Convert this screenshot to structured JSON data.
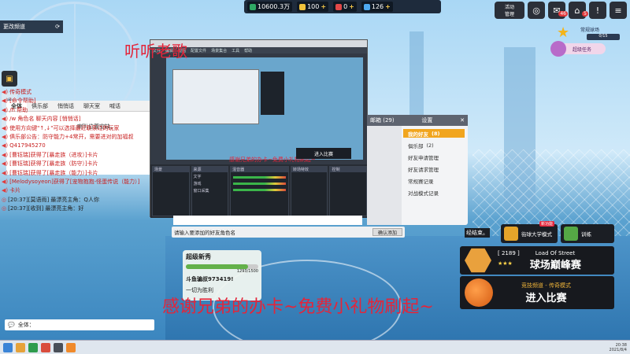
{
  "topbar": {
    "rank_points": "10600.3万",
    "coins": "100",
    "gems": "0",
    "tickets": "126"
  },
  "top_icons": {
    "event_label": "活动",
    "manager_label": "管理",
    "badge_mail": "46",
    "badge_store": "5"
  },
  "left": {
    "channel_button": "更改频道",
    "side_icon_labels": [
      "",
      "",
      ""
    ],
    "chat_tabs": [
      "全体",
      "俱乐部",
      "悄悄话",
      "聊天室",
      "喊话"
    ],
    "notice_text": "喇叭位置空缺。",
    "chat_lines": [
      {
        "cls": "red",
        "text": "传奇模式"
      },
      {
        "cls": "red",
        "text": "[命令帮助]"
      },
      {
        "cls": "red",
        "text": "/h 帮助"
      },
      {
        "cls": "red",
        "text": "/w 角色名 聊天内容 [悄悄话]"
      },
      {
        "cls": "red",
        "text": "使用方向键\"↑,↓\"可以选择最近联系过的玩家"
      },
      {
        "cls": "red",
        "text": "俱乐部公告：防守能力+4常开，需要进对的加福叔"
      },
      {
        "cls": "red",
        "text": "Q417945270"
      },
      {
        "cls": "red",
        "text": "[曹钰瑞]获得了[暴走族（进攻）]卡片"
      },
      {
        "cls": "red",
        "text": "[曹钰瑞]获得了[暴走族（防守）]卡片"
      },
      {
        "cls": "red",
        "text": "[曹钰瑞]获得了[暴走族（能力）]卡片"
      },
      {
        "cls": "red",
        "text": "[Melodysoyeon]获得了[宠物抱抱-怪蛋传说（能力）]"
      },
      {
        "cls": "red",
        "text": "卡片"
      },
      {
        "cls": "dark",
        "text": "[20:37][莫语雨] 最漂亮主角：Q人你"
      },
      {
        "cls": "dark",
        "text": "[20:37][收到] 最漂亮主角：好"
      }
    ],
    "chat_input_label": "全体："
  },
  "overlay": {
    "title": "听听老歌",
    "subtitle": "感谢兄弟的办卡~免费小礼物刷起~"
  },
  "obs": {
    "menu": [
      "文件",
      "编辑",
      "视图",
      "配置文件",
      "场景集合",
      "工具",
      "帮助"
    ],
    "preview_text": "感谢兄弟的办卡~免费小礼物刷起~",
    "preview_btn": "进入比赛",
    "docks": [
      "场景",
      "来源",
      "混音器",
      "转场特效",
      "控制"
    ],
    "sources": [
      "文字",
      "游戏",
      "窗口采集"
    ]
  },
  "settings": {
    "tab_mail": "邮箱",
    "mail_count": "(29)",
    "title": "设置",
    "items": [
      {
        "label": "我的好友",
        "count": "(8)",
        "active": true
      },
      {
        "label": "俱乐部",
        "count": "(2)",
        "active": false
      },
      {
        "label": "好友申请管理",
        "count": "",
        "active": false
      },
      {
        "label": "好友请求管理",
        "count": "",
        "active": false
      },
      {
        "label": "常规赛记录",
        "count": "",
        "active": false
      },
      {
        "label": "对战模式记录",
        "count": "",
        "active": false
      }
    ]
  },
  "middle": {
    "add_placeholder": "请输入要添加的好友角色名",
    "add_button": "确认添加",
    "end_label": "经结束。"
  },
  "season": {
    "title": "超级新秀",
    "progress_text": "1293/1500",
    "progress": 0.86,
    "line1": "斗鱼骗叔973419!",
    "line2": "一切为胜利"
  },
  "right": {
    "rank_title": "常规球场",
    "rank_count": "0/15",
    "task_button": "超级任务",
    "mini1": {
      "tag": "新功能",
      "label": "街球大学模式"
    },
    "mini2": {
      "label": "训练"
    },
    "ladder": {
      "rating": "[ 2189 ]",
      "stars": "★★★",
      "sub": "Load Of Street",
      "main": "球场巅峰赛"
    },
    "match": {
      "sub": "竞技频道 - 传奇模式",
      "main": "进入比赛"
    }
  },
  "taskbar": {
    "time": "20:38",
    "date": "2021/8/4"
  },
  "colors": {
    "accent_orange": "#f1a51e",
    "alert_red": "#e3253a",
    "dark_card": "#17191e"
  }
}
